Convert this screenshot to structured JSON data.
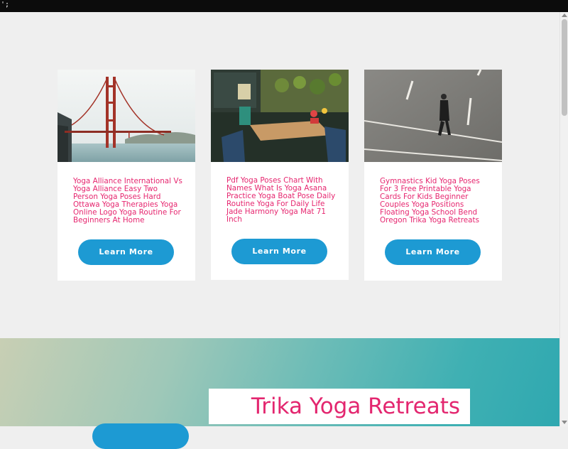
{
  "topbar": {
    "text": "';"
  },
  "cards": [
    {
      "image_alt": "golden-gate-bridge",
      "title": "Yoga Alliance International Vs Yoga Alliance Easy Two Person Yoga Poses Hard Ottawa Yoga Therapies Yoga Online Logo Yoga Routine For Beginners At Home",
      "button": "Learn More"
    },
    {
      "image_alt": "cafe-terrace",
      "title": "Pdf Yoga Poses Chart With Names What Is Yoga Asana Practice Yoga Boat Pose Daily Routine Yoga For Daily Life Jade Harmony Yoga Mat 71 Inch",
      "button": "Learn More"
    },
    {
      "image_alt": "man-walking-on-street",
      "title": "Gymnastics Kid Yoga Poses For 3 Free Printable Yoga Cards For Kids Beginner Couples Yoga Positions Floating Yoga School Bend Oregon Trika Yoga Retreats",
      "button": "Learn More"
    }
  ],
  "hero": {
    "title": "Trika Yoga Retreats"
  },
  "colors": {
    "accent": "#e6266f",
    "button": "#1d9ad3"
  }
}
